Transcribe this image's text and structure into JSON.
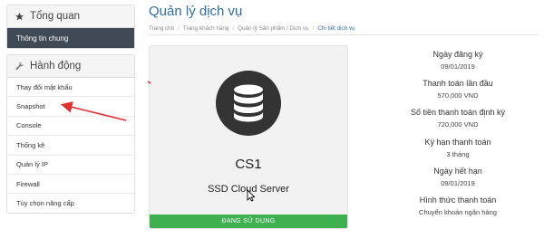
{
  "sidebar": {
    "overview": {
      "title": "Tổng quan",
      "icon": "star-icon",
      "active_item": "Thông tin chung"
    },
    "actions": {
      "title": "Hành động",
      "icon": "wrench-icon",
      "items": [
        {
          "label": "Thay đổi mật khẩu"
        },
        {
          "label": "Snapshot"
        },
        {
          "label": "Console"
        },
        {
          "label": "Thống kê"
        },
        {
          "label": "Quản lý IP"
        },
        {
          "label": "Firewall"
        },
        {
          "label": "Tùy chọn nâng cấp"
        }
      ]
    }
  },
  "header": {
    "title": "Quản lý dịch vụ",
    "breadcrumb": [
      "Trang chủ",
      "Trang khách hàng",
      "Quản lý Sản phẩm / Dịch vụ",
      "Chi tiết dịch vụ"
    ]
  },
  "product": {
    "icon": "database-icon",
    "name": "CS1",
    "type": "SSD Cloud Server",
    "status": "ĐANG SỬ DỤNG",
    "status_color": "#3fb050"
  },
  "details": [
    {
      "label": "Ngày đăng ký",
      "value": "09/01/2019"
    },
    {
      "label": "Thanh toán lần đầu",
      "value": "570,000 VND"
    },
    {
      "label": "Số tiền thanh toán định kỳ",
      "value": "720,000 VND"
    },
    {
      "label": "Kỳ hạn thanh toán",
      "value": "3 tháng"
    },
    {
      "label": "Ngày hết hạn",
      "value": "09/01/2019"
    },
    {
      "label": "Hình thức thanh toán",
      "value": "Chuyển khoản ngân hàng"
    }
  ],
  "colors": {
    "accent": "#2f6ea5",
    "sidebar_active": "#404a57",
    "annotation_arrow": "#e03030"
  }
}
